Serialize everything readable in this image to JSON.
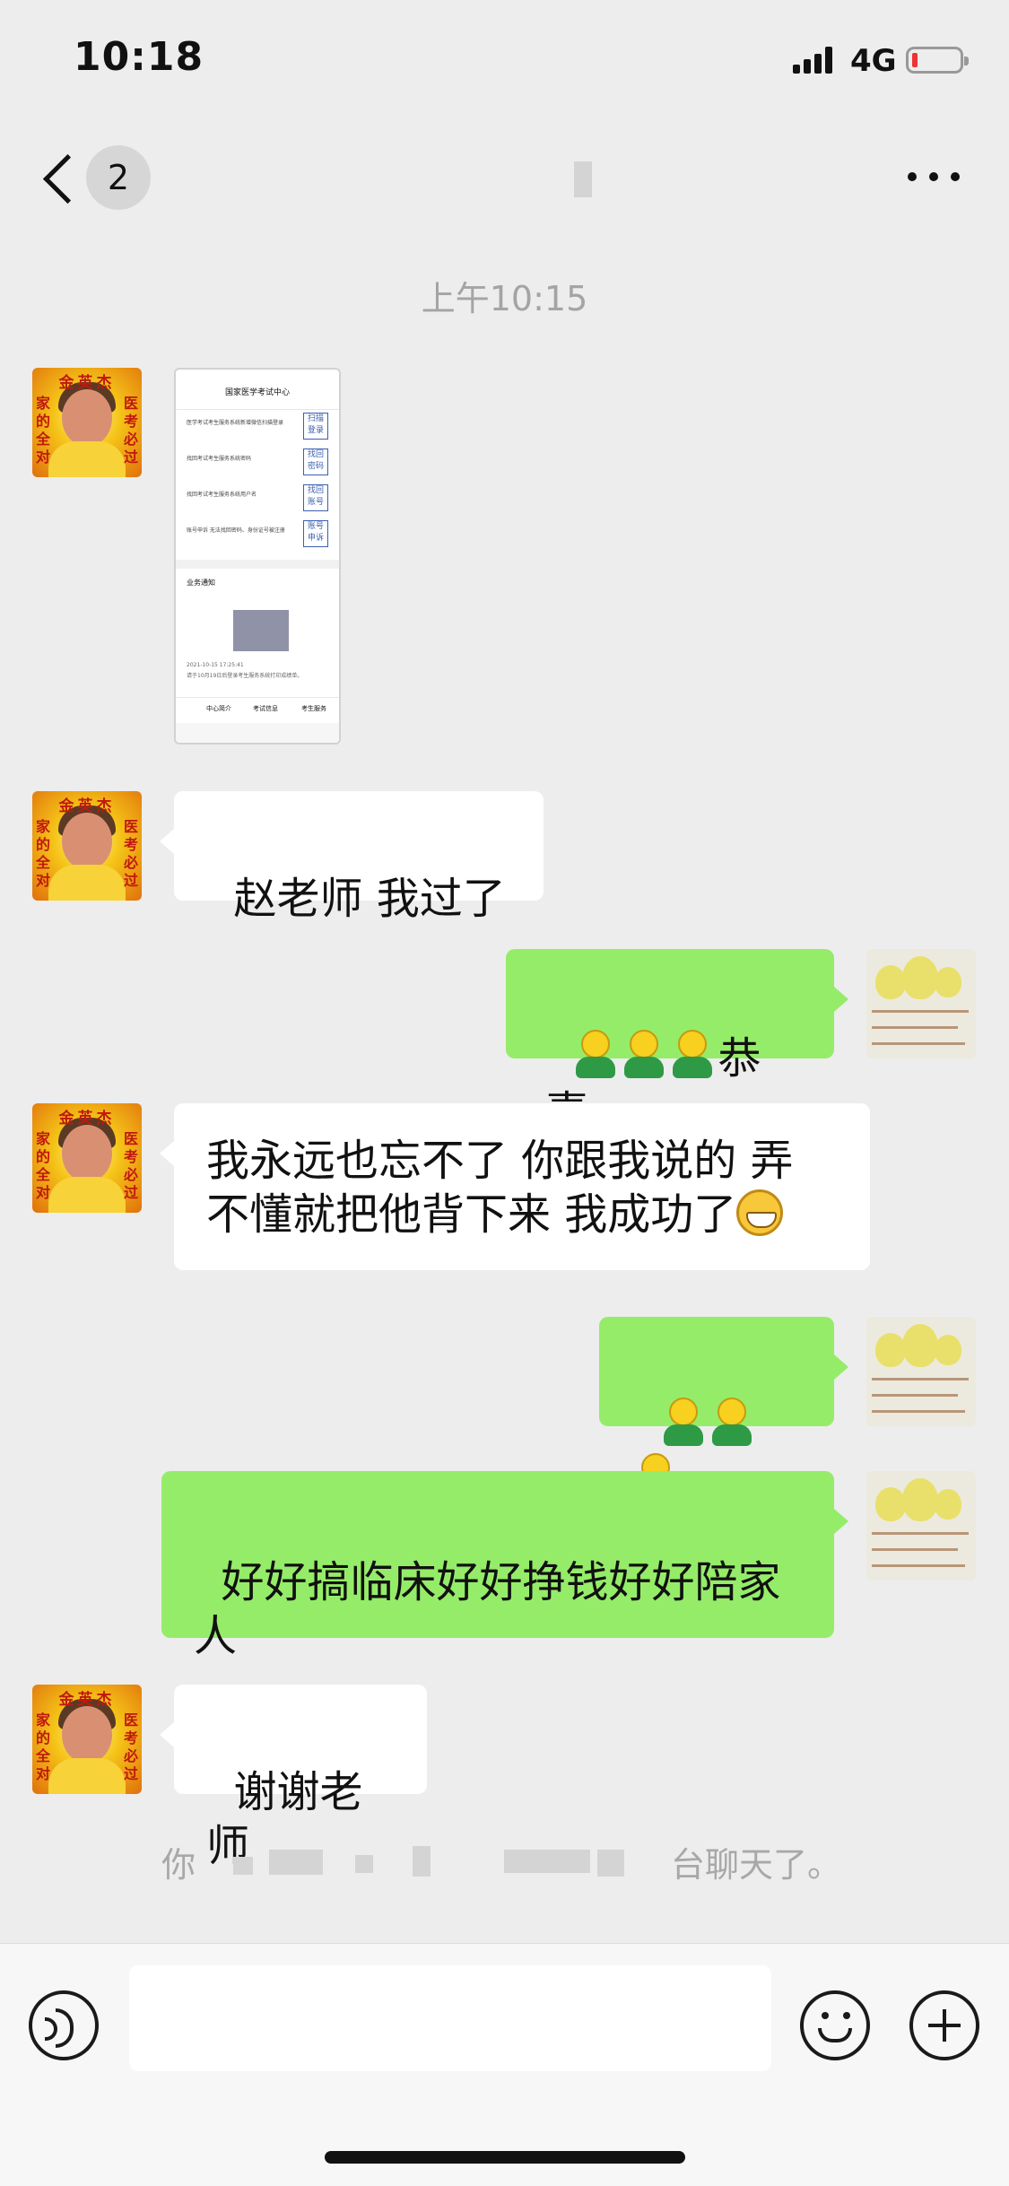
{
  "status_bar": {
    "time": "10:18",
    "network": "4G"
  },
  "nav": {
    "unread_count": "2"
  },
  "chat": {
    "timestamp": "上午10:15",
    "messages": [
      {
        "from": "teacher",
        "type": "image"
      },
      {
        "from": "teacher",
        "text": "赵老师 我过了"
      },
      {
        "from": "me",
        "text": "恭喜",
        "emoji": "hug-emoji",
        "emoji_count": 3
      },
      {
        "from": "teacher",
        "text_line1": "我永远也忘不了 你跟我说的 弄",
        "text_line2": "不懂就把他背下来 我成功了",
        "emoji": "grin-emoji"
      },
      {
        "from": "me",
        "text": "",
        "emoji": "hug-emoji",
        "emoji_count": 3
      },
      {
        "from": "me",
        "text": "好好搞临床好好挣钱好好陪家\n人"
      },
      {
        "from": "teacher",
        "text": "谢谢老师"
      }
    ],
    "system_message": {
      "prefix": "你",
      "suffix": "台聊天了。"
    }
  },
  "avatar_teacher": {
    "top_text": "金英杰",
    "left_text": "家的全对",
    "right_text": "医考必过"
  },
  "shared_screenshot": {
    "title": "国家医学考试中心",
    "rows": [
      {
        "text": "医学考试考生服务系统新增微信扫描登录",
        "button": "扫描登录"
      },
      {
        "text": "找回考试考生服务系统密码",
        "button": "找回密码"
      },
      {
        "text": "找回考试考生服务系统用户名",
        "button": "找回账号"
      },
      {
        "text": "账号申诉 无法找回密码、身份证号被注册",
        "button": "账号申诉"
      }
    ],
    "card_title": "业务通知",
    "card_time": "2021-10-15 17:25:41",
    "card_note": "请于10月19日后登录考生服务系统打印成绩单。",
    "tabs": [
      "中心简介",
      "考试信息",
      "考生服务"
    ]
  },
  "colors": {
    "background": "#ededed",
    "bubble_out": "#95ec69",
    "bubble_in": "#ffffff",
    "timestamp": "#a4a4a4"
  }
}
